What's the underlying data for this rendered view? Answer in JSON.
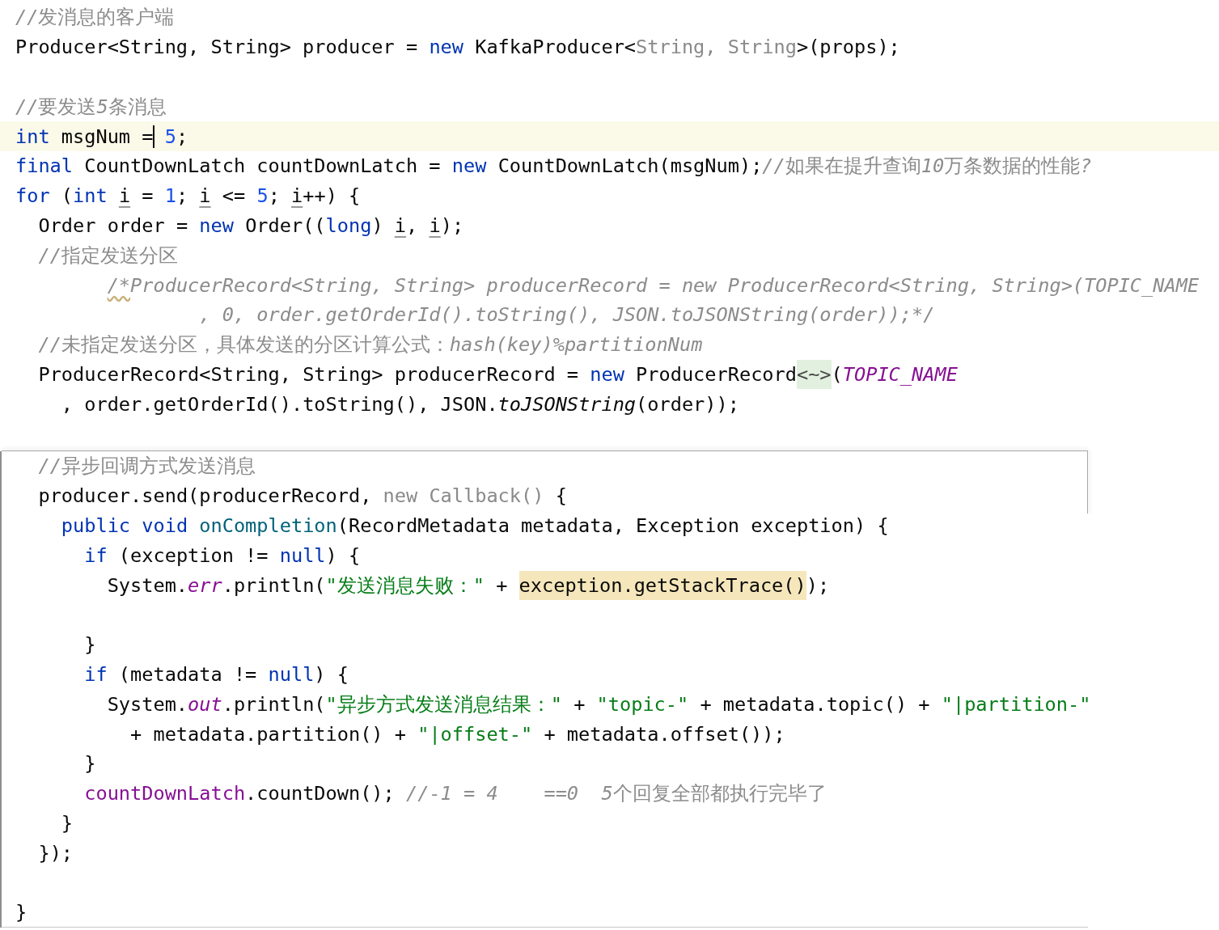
{
  "editor": {
    "lines": [
      {
        "kind": "code",
        "current": false,
        "tokens": [
          {
            "text": "//发消息的客户端",
            "kind": "comment"
          }
        ]
      },
      {
        "kind": "code",
        "current": false,
        "tokens": [
          {
            "text": "Producer<String, String> producer = ",
            "kind": "plain"
          },
          {
            "text": "new",
            "kind": "keyword"
          },
          {
            "text": " KafkaProducer<",
            "kind": "plain"
          },
          {
            "text": "String, String",
            "kind": "redundant"
          },
          {
            "text": ">(props);",
            "kind": "plain"
          }
        ]
      },
      {
        "kind": "blank",
        "current": false
      },
      {
        "kind": "code",
        "current": false,
        "tokens": [
          {
            "text": "//要发送5条消息",
            "kind": "comment"
          }
        ]
      },
      {
        "kind": "code",
        "current": true,
        "tokens": [
          {
            "text": "int",
            "kind": "keyword"
          },
          {
            "text": " msgNum =",
            "kind": "plain"
          },
          {
            "text": " 5",
            "kind": "number",
            "caret": true
          },
          {
            "text": ";",
            "kind": "plain"
          }
        ]
      },
      {
        "kind": "code",
        "current": false,
        "tokens": [
          {
            "text": "final",
            "kind": "keyword"
          },
          {
            "text": " CountDownLatch countDownLatch = ",
            "kind": "plain"
          },
          {
            "text": "new",
            "kind": "keyword"
          },
          {
            "text": " CountDownLatch(msgNum);",
            "kind": "plain"
          },
          {
            "text": "//如果在提升查询10万条数据的性能?",
            "kind": "comment"
          }
        ]
      },
      {
        "kind": "code",
        "current": false,
        "tokens": [
          {
            "text": "for",
            "kind": "keyword"
          },
          {
            "text": " (",
            "kind": "plain"
          },
          {
            "text": "int ",
            "kind": "keyword"
          },
          {
            "text": "i",
            "kind": "reassigned"
          },
          {
            "text": " = ",
            "kind": "plain"
          },
          {
            "text": "1",
            "kind": "number"
          },
          {
            "text": "; ",
            "kind": "plain"
          },
          {
            "text": "i",
            "kind": "reassigned"
          },
          {
            "text": " <= ",
            "kind": "plain"
          },
          {
            "text": "5",
            "kind": "number"
          },
          {
            "text": "; ",
            "kind": "plain"
          },
          {
            "text": "i",
            "kind": "reassigned"
          },
          {
            "text": "++) {",
            "kind": "plain"
          }
        ]
      },
      {
        "kind": "code",
        "current": false,
        "tokens": [
          {
            "text": "  Order order = ",
            "kind": "plain"
          },
          {
            "text": "new",
            "kind": "keyword"
          },
          {
            "text": " Order((",
            "kind": "plain"
          },
          {
            "text": "long",
            "kind": "keyword"
          },
          {
            "text": ") ",
            "kind": "plain"
          },
          {
            "text": "i",
            "kind": "reassigned"
          },
          {
            "text": ", ",
            "kind": "plain"
          },
          {
            "text": "i",
            "kind": "reassigned"
          },
          {
            "text": ");",
            "kind": "plain"
          }
        ]
      },
      {
        "kind": "code",
        "current": false,
        "tokens": [
          {
            "text": "  //指定发送分区",
            "kind": "comment"
          }
        ]
      },
      {
        "kind": "code",
        "current": false,
        "tokens": [
          {
            "text": "        /*",
            "kind": "comment",
            "warning": true
          },
          {
            "text": "ProducerRecord<String, String> producerRecord = new ProducerRecord<String, String>(TOPIC_NAME",
            "kind": "comment"
          }
        ]
      },
      {
        "kind": "code",
        "current": false,
        "tokens": [
          {
            "text": "                , 0, order.getOrderId().toString(), JSON.toJSONString(order));*/",
            "kind": "comment"
          }
        ]
      },
      {
        "kind": "code",
        "current": false,
        "tokens": [
          {
            "text": "  //未指定发送分区，具体发送的分区计算公式：hash(key)%partitionNum",
            "kind": "comment"
          }
        ]
      },
      {
        "kind": "code",
        "current": false,
        "tokens": [
          {
            "text": "  ProducerRecord<String, String> producerRecord = ",
            "kind": "plain"
          },
          {
            "text": "new",
            "kind": "keyword"
          },
          {
            "text": " ProducerRecord",
            "kind": "plain"
          },
          {
            "text": "<~>",
            "kind": "fold"
          },
          {
            "text": "(",
            "kind": "plain"
          },
          {
            "text": "TOPIC_NAME",
            "kind": "field"
          }
        ]
      },
      {
        "kind": "code",
        "current": false,
        "tokens": [
          {
            "text": "    , order.getOrderId().toString(), JSON.",
            "kind": "plain"
          },
          {
            "text": "toJSONString",
            "kind": "static_method"
          },
          {
            "text": "(order));",
            "kind": "plain"
          }
        ]
      },
      {
        "kind": "blank",
        "current": false
      }
    ]
  },
  "overlay_panel": {
    "lines": [
      {
        "kind": "code",
        "current": false,
        "tokens": [
          {
            "text": "  //异步回调方式发送消息",
            "kind": "comment"
          }
        ]
      },
      {
        "kind": "code",
        "current": false,
        "tokens": [
          {
            "text": "  producer.send(producerRecord, ",
            "kind": "plain"
          },
          {
            "text": "new Callback()",
            "kind": "redundant"
          },
          {
            "text": " {",
            "kind": "plain"
          }
        ]
      },
      {
        "kind": "code",
        "current": false,
        "tokens": [
          {
            "text": "    public ",
            "kind": "keyword"
          },
          {
            "text": "void ",
            "kind": "keyword"
          },
          {
            "text": "onCompletion",
            "kind": "method_decl"
          },
          {
            "text": "(RecordMetadata metadata, Exception exception) {",
            "kind": "plain"
          }
        ]
      },
      {
        "kind": "code",
        "current": false,
        "tokens": [
          {
            "text": "      if",
            "kind": "keyword"
          },
          {
            "text": " (exception != ",
            "kind": "plain"
          },
          {
            "text": "null",
            "kind": "keyword"
          },
          {
            "text": ") {",
            "kind": "plain"
          }
        ]
      },
      {
        "kind": "code",
        "current": false,
        "tokens": [
          {
            "text": "        System.",
            "kind": "plain"
          },
          {
            "text": "err",
            "kind": "field"
          },
          {
            "text": ".println(",
            "kind": "plain"
          },
          {
            "text": "\"发送消息失败：\"",
            "kind": "string"
          },
          {
            "text": " + ",
            "kind": "plain"
          },
          {
            "text": "exception.getStackTrace()",
            "kind": "plain",
            "highlighted": true
          },
          {
            "text": ");",
            "kind": "plain"
          }
        ]
      },
      {
        "kind": "blank",
        "current": false
      },
      {
        "kind": "code",
        "current": false,
        "tokens": [
          {
            "text": "      }",
            "kind": "plain"
          }
        ]
      },
      {
        "kind": "code",
        "current": false,
        "tokens": [
          {
            "text": "      if",
            "kind": "keyword"
          },
          {
            "text": " (metadata != ",
            "kind": "plain"
          },
          {
            "text": "null",
            "kind": "keyword"
          },
          {
            "text": ") {",
            "kind": "plain"
          }
        ]
      },
      {
        "kind": "code",
        "current": false,
        "tokens": [
          {
            "text": "        System.",
            "kind": "plain"
          },
          {
            "text": "out",
            "kind": "field"
          },
          {
            "text": ".println(",
            "kind": "plain"
          },
          {
            "text": "\"异步方式发送消息结果：\"",
            "kind": "string"
          },
          {
            "text": " + ",
            "kind": "plain"
          },
          {
            "text": "\"topic-\"",
            "kind": "string"
          },
          {
            "text": " + metadata.topic() + ",
            "kind": "plain"
          },
          {
            "text": "\"|partition-\"",
            "kind": "string"
          }
        ]
      },
      {
        "kind": "code",
        "current": false,
        "tokens": [
          {
            "text": "          + metadata.partition() + ",
            "kind": "plain"
          },
          {
            "text": "\"|offset-\"",
            "kind": "string"
          },
          {
            "text": " + metadata.offset());",
            "kind": "plain"
          }
        ]
      },
      {
        "kind": "code",
        "current": false,
        "tokens": [
          {
            "text": "      }",
            "kind": "plain"
          }
        ]
      },
      {
        "kind": "code",
        "current": false,
        "tokens": [
          {
            "text": "      countDownLatch",
            "kind": "captured"
          },
          {
            "text": ".countDown(); ",
            "kind": "plain"
          },
          {
            "text": "//-1 = 4    ==0  5个回复全部都执行完毕了",
            "kind": "comment"
          }
        ]
      },
      {
        "kind": "code",
        "current": false,
        "tokens": [
          {
            "text": "    }",
            "kind": "plain"
          }
        ]
      },
      {
        "kind": "code",
        "current": false,
        "tokens": [
          {
            "text": "  });",
            "kind": "plain"
          }
        ]
      },
      {
        "kind": "blank",
        "current": false
      },
      {
        "kind": "code",
        "current": false,
        "tokens": [
          {
            "text": "}",
            "kind": "plain"
          }
        ]
      }
    ]
  }
}
